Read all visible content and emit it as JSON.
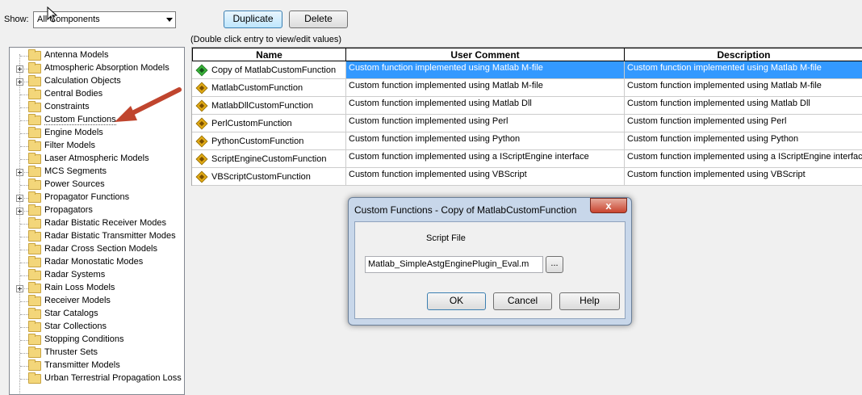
{
  "show": {
    "label": "Show:",
    "selected": "All Components"
  },
  "toolbar": {
    "duplicate_label": "Duplicate",
    "delete_label": "Delete"
  },
  "hint": "(Double click entry to view/edit values)",
  "tree": {
    "items": [
      {
        "label": "Antenna Models",
        "expandable": false
      },
      {
        "label": "Atmospheric Absorption Models",
        "expandable": true
      },
      {
        "label": "Calculation Objects",
        "expandable": true
      },
      {
        "label": "Central Bodies",
        "expandable": false
      },
      {
        "label": "Constraints",
        "expandable": false
      },
      {
        "label": "Custom Functions",
        "expandable": false,
        "selected": true
      },
      {
        "label": "Engine Models",
        "expandable": false
      },
      {
        "label": "Filter Models",
        "expandable": false
      },
      {
        "label": "Laser Atmospheric Models",
        "expandable": false
      },
      {
        "label": "MCS Segments",
        "expandable": true
      },
      {
        "label": "Power Sources",
        "expandable": false
      },
      {
        "label": "Propagator Functions",
        "expandable": true
      },
      {
        "label": "Propagators",
        "expandable": true
      },
      {
        "label": "Radar Bistatic Receiver Modes",
        "expandable": false
      },
      {
        "label": "Radar Bistatic Transmitter Modes",
        "expandable": false
      },
      {
        "label": "Radar Cross Section Models",
        "expandable": false
      },
      {
        "label": "Radar Monostatic Modes",
        "expandable": false
      },
      {
        "label": "Radar Systems",
        "expandable": false
      },
      {
        "label": "Rain Loss Models",
        "expandable": true
      },
      {
        "label": "Receiver Models",
        "expandable": false
      },
      {
        "label": "Star Catalogs",
        "expandable": false
      },
      {
        "label": "Star Collections",
        "expandable": false
      },
      {
        "label": "Stopping Conditions",
        "expandable": false
      },
      {
        "label": "Thruster Sets",
        "expandable": false
      },
      {
        "label": "Transmitter Models",
        "expandable": false
      },
      {
        "label": "Urban Terrestrial Propagation Loss Models",
        "expandable": false
      }
    ]
  },
  "table": {
    "headers": {
      "name": "Name",
      "comment": "User Comment",
      "description": "Description"
    },
    "rows": [
      {
        "name": "Copy of MatlabCustomFunction",
        "comment": "Custom function implemented using Matlab M-file",
        "description": "Custom function implemented using Matlab M-file",
        "icon": "plugin-green-icon",
        "selected": true
      },
      {
        "name": "MatlabCustomFunction",
        "comment": "Custom function implemented using Matlab M-file",
        "description": "Custom function implemented using Matlab M-file",
        "icon": "plugin-icon"
      },
      {
        "name": "MatlabDllCustomFunction",
        "comment": "Custom function implemented using Matlab Dll",
        "description": "Custom function implemented using Matlab Dll",
        "icon": "plugin-icon"
      },
      {
        "name": "PerlCustomFunction",
        "comment": "Custom function implemented using Perl",
        "description": "Custom function implemented using Perl",
        "icon": "plugin-icon"
      },
      {
        "name": "PythonCustomFunction",
        "comment": "Custom function implemented using Python",
        "description": "Custom function implemented using Python",
        "icon": "plugin-icon"
      },
      {
        "name": "ScriptEngineCustomFunction",
        "comment": "Custom function implemented using a IScriptEngine interface",
        "description": "Custom function implemented using a IScriptEngine interface",
        "icon": "plugin-icon"
      },
      {
        "name": "VBScriptCustomFunction",
        "comment": "Custom function implemented using VBScript",
        "description": "Custom function implemented using VBScript",
        "icon": "plugin-icon"
      }
    ]
  },
  "dialog": {
    "title": "Custom Functions - Copy of MatlabCustomFunction",
    "close_label": "x",
    "script_label": "Script File",
    "script_value": "Matlab_SimpleAstgEnginePlugin_Eval.m",
    "browse_label": "...",
    "ok_label": "OK",
    "cancel_label": "Cancel",
    "help_label": "Help"
  },
  "colors": {
    "selection": "#3399ff",
    "arrow": "#c0452e",
    "dialog_frame": "#c8d7ea"
  }
}
